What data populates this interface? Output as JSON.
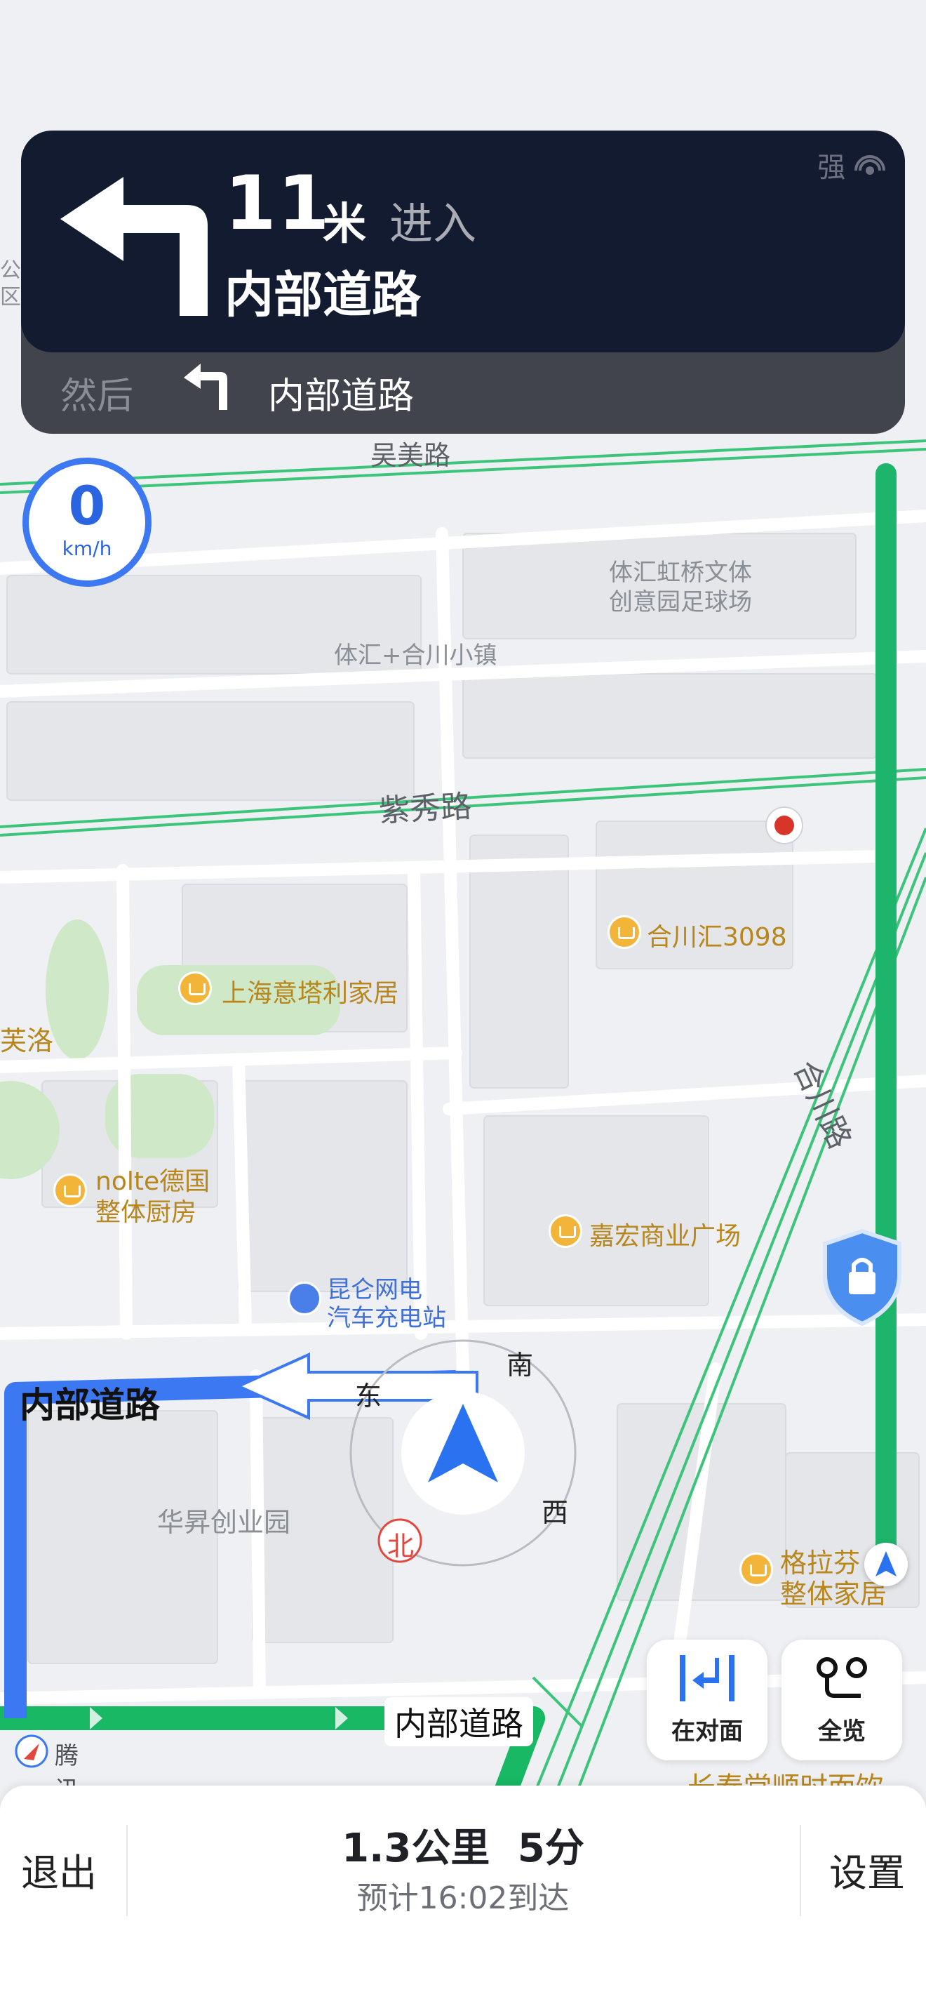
{
  "navigation": {
    "distance_value": "11",
    "distance_unit": "米",
    "enter_label": "进入",
    "road_name": "内部道路",
    "signal_label": "强",
    "then_label": "然后",
    "then_road": "内部道路"
  },
  "speed": {
    "value": "0",
    "unit": "km/h"
  },
  "map": {
    "roads": [
      "吴美路",
      "紫秀路",
      "合川路",
      "内部道路",
      "内部道路"
    ],
    "pois": [
      "体汇虹桥文体",
      "创意园足球场",
      "体汇+合川小镇",
      "合川汇3098",
      "上海意塔利家居",
      "nolte德国",
      "整体厨房",
      "嘉宏商业广场",
      "昆仑网电",
      "汽车充电站",
      "华昇创业园",
      "格拉芬",
      "整体家居",
      "长春堂顺时而饮",
      "芙洛",
      "公",
      "区"
    ],
    "compass": {
      "north": "北",
      "south": "南",
      "east": "东",
      "west": "西"
    },
    "watermark": "腾讯地图"
  },
  "colors": {
    "route_blue": "#3d78f3",
    "route_green": "#1db46b",
    "card_dark": "#131b31"
  },
  "map_buttons": {
    "opposite_label": "在对面",
    "overview_label": "全览"
  },
  "bottom_bar": {
    "exit_label": "退出",
    "distance": "1.3公里",
    "time": "5分",
    "eta": "预计16:02到达",
    "settings_label": "设置"
  }
}
